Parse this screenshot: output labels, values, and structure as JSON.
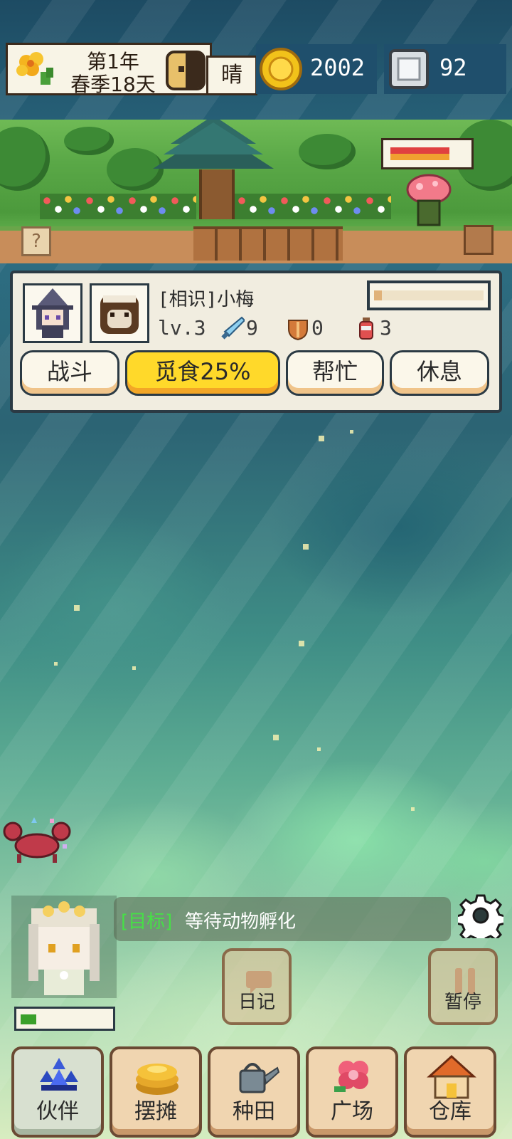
{
  "header": {
    "year_line": "第1年",
    "season_day_line": "春季18天",
    "weather": "晴",
    "coins": "2002",
    "gems": "92"
  },
  "scene": {
    "help_glyph": "?",
    "enemy_hp_fraction": 0.8
  },
  "companion": {
    "name": "[相识]小梅",
    "level": "lv.3",
    "attack": "9",
    "defense": "0",
    "potions": "3",
    "mood_fraction": 0.07,
    "actions": [
      {
        "label": "战斗",
        "active": false
      },
      {
        "label": "觅食25%",
        "active": true
      },
      {
        "label": "帮忙",
        "active": false
      },
      {
        "label": "休息",
        "active": false
      }
    ]
  },
  "hud": {
    "goal_prefix": "[目标]",
    "goal_text": "等待动物孵化",
    "player_hp_fraction": 0.18,
    "diary_label": "日记",
    "pause_label": "暂停"
  },
  "nav": [
    {
      "label": "伙伴",
      "icon": "crystal-icon",
      "active": true
    },
    {
      "label": "摆摊",
      "icon": "pancake-icon",
      "active": false
    },
    {
      "label": "种田",
      "icon": "watering-can-icon",
      "active": false
    },
    {
      "label": "广场",
      "icon": "flower-icon",
      "active": false
    },
    {
      "label": "仓库",
      "icon": "house-icon",
      "active": false
    }
  ],
  "colors": {
    "accent_yellow": "#ffd92a",
    "panel_bg": "#f1ede0",
    "goal_prefix": "#46e046"
  }
}
